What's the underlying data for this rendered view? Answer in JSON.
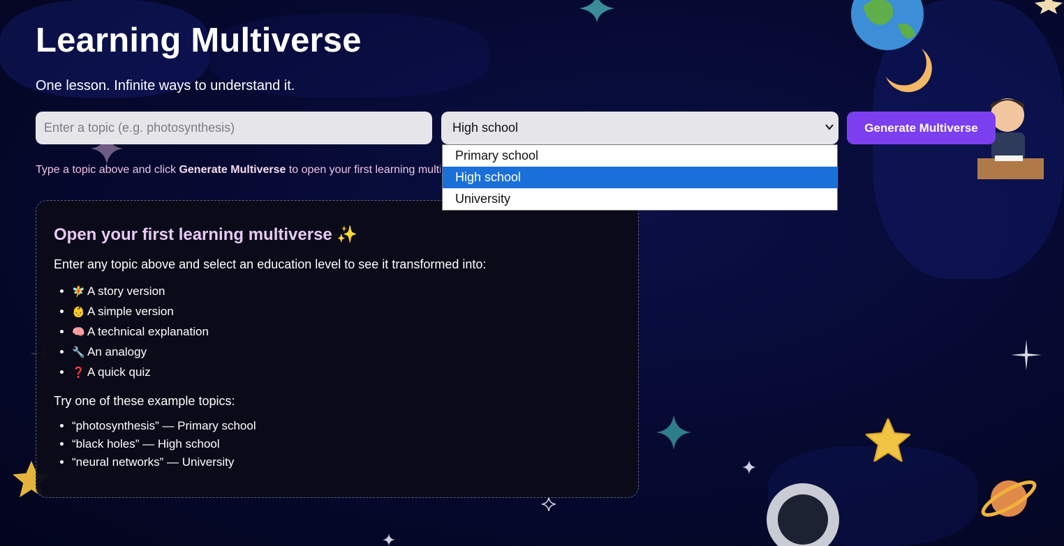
{
  "header": {
    "title": "Learning Multiverse",
    "subtitle": "One lesson. Infinite ways to understand it."
  },
  "form": {
    "topic_placeholder": "Enter a topic (e.g. photosynthesis)",
    "topic_value": "",
    "level_selected": "High school",
    "level_options": [
      "Primary school",
      "High school",
      "University"
    ],
    "generate_label": "Generate Multiverse"
  },
  "hint": {
    "prefix": "Type a topic above and click ",
    "strong": "Generate Multiverse",
    "suffix": " to open your first learning multiverse."
  },
  "card": {
    "heading": "Open your first learning multiverse ✨",
    "intro": "Enter any topic above and select an education level to see it transformed into:",
    "modes": [
      {
        "icon": "🧚",
        "label": "A story version"
      },
      {
        "icon": "👶",
        "label": "A simple version"
      },
      {
        "icon": "🧠",
        "label": "A technical explanation"
      },
      {
        "icon": "🔧",
        "label": "An analogy"
      },
      {
        "icon": "❓",
        "label": "A quick quiz"
      }
    ],
    "try_label": "Try one of these example topics:",
    "examples": [
      "“photosynthesis” — Primary school",
      "“black holes” — High school",
      "“neural networks” — University"
    ]
  },
  "colors": {
    "accent": "#7b3ff0",
    "heading_pink": "#e9c9f6",
    "selected_option": "#1a6fd8"
  }
}
